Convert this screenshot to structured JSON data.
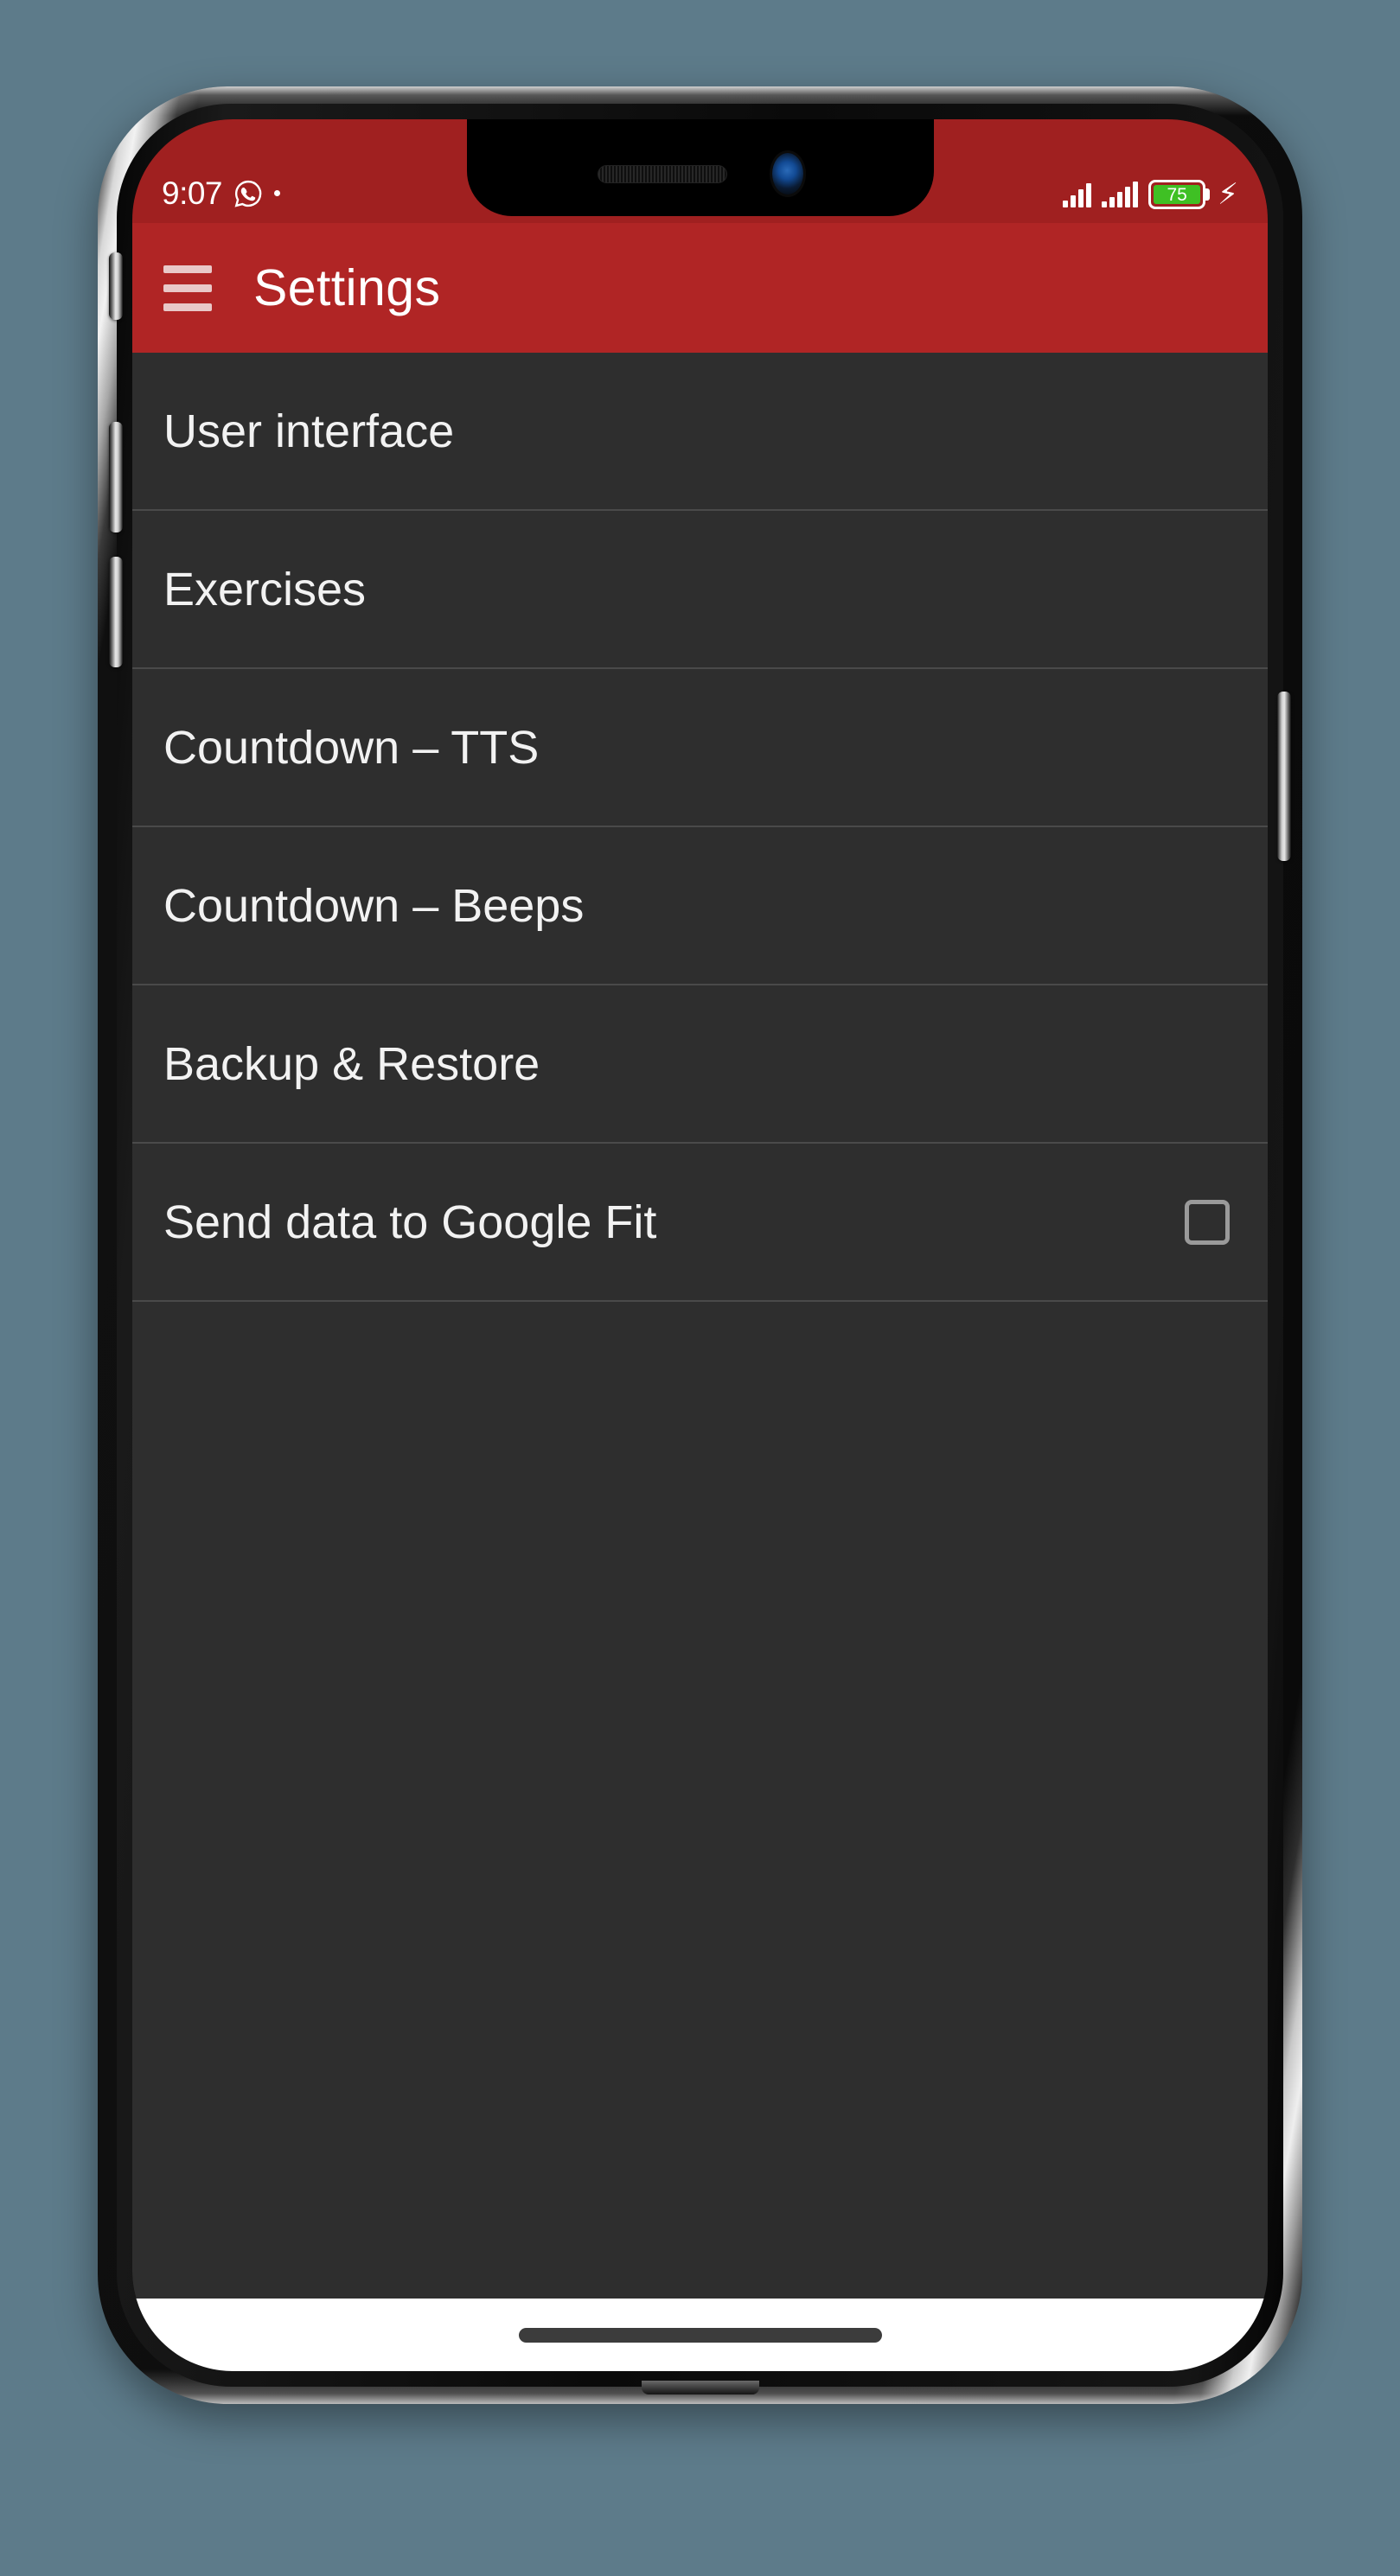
{
  "scene": {
    "background_color": "#5d7b8a",
    "device": "smartphone-mockup"
  },
  "status_bar": {
    "time": "9:07",
    "background_color": "#a02020",
    "left_icons": [
      {
        "name": "whatsapp-icon",
        "glyph": "whatsapp"
      },
      {
        "name": "notification-dot-icon",
        "glyph": "dot"
      }
    ],
    "right_icons": [
      {
        "name": "signal-bars-sim1-icon",
        "bars": 4
      },
      {
        "name": "signal-bars-sim2-icon",
        "bars": 5
      },
      {
        "name": "battery-icon",
        "level": "75"
      },
      {
        "name": "charging-bolt-icon",
        "glyph": "⚡"
      }
    ],
    "battery_level": "75",
    "battery_fill_color": "#3fc024"
  },
  "app_bar": {
    "title": "Settings",
    "background_color": "#b02525",
    "menu_icon": "hamburger-menu-icon",
    "menu_icon_color": "#e9c8c8"
  },
  "list": {
    "background_color": "#2e2e2e",
    "divider_color": "#4a4a4a",
    "text_color": "#f2f2f2",
    "items": [
      {
        "label": "User interface",
        "name": "settings-row-user-interface",
        "control": "none"
      },
      {
        "label": "Exercises",
        "name": "settings-row-exercises",
        "control": "none"
      },
      {
        "label": "Countdown – TTS",
        "name": "settings-row-countdown-tts",
        "control": "none"
      },
      {
        "label": "Countdown – Beeps",
        "name": "settings-row-countdown-beeps",
        "control": "none"
      },
      {
        "label": "Backup & Restore",
        "name": "settings-row-backup-restore",
        "control": "none"
      },
      {
        "label": "Send data to Google Fit",
        "name": "settings-row-google-fit",
        "control": "checkbox",
        "checked": false
      }
    ]
  },
  "nav_bar": {
    "type": "gesture-pill",
    "background_color": "#ffffff",
    "pill_color": "#3c3c3c"
  }
}
